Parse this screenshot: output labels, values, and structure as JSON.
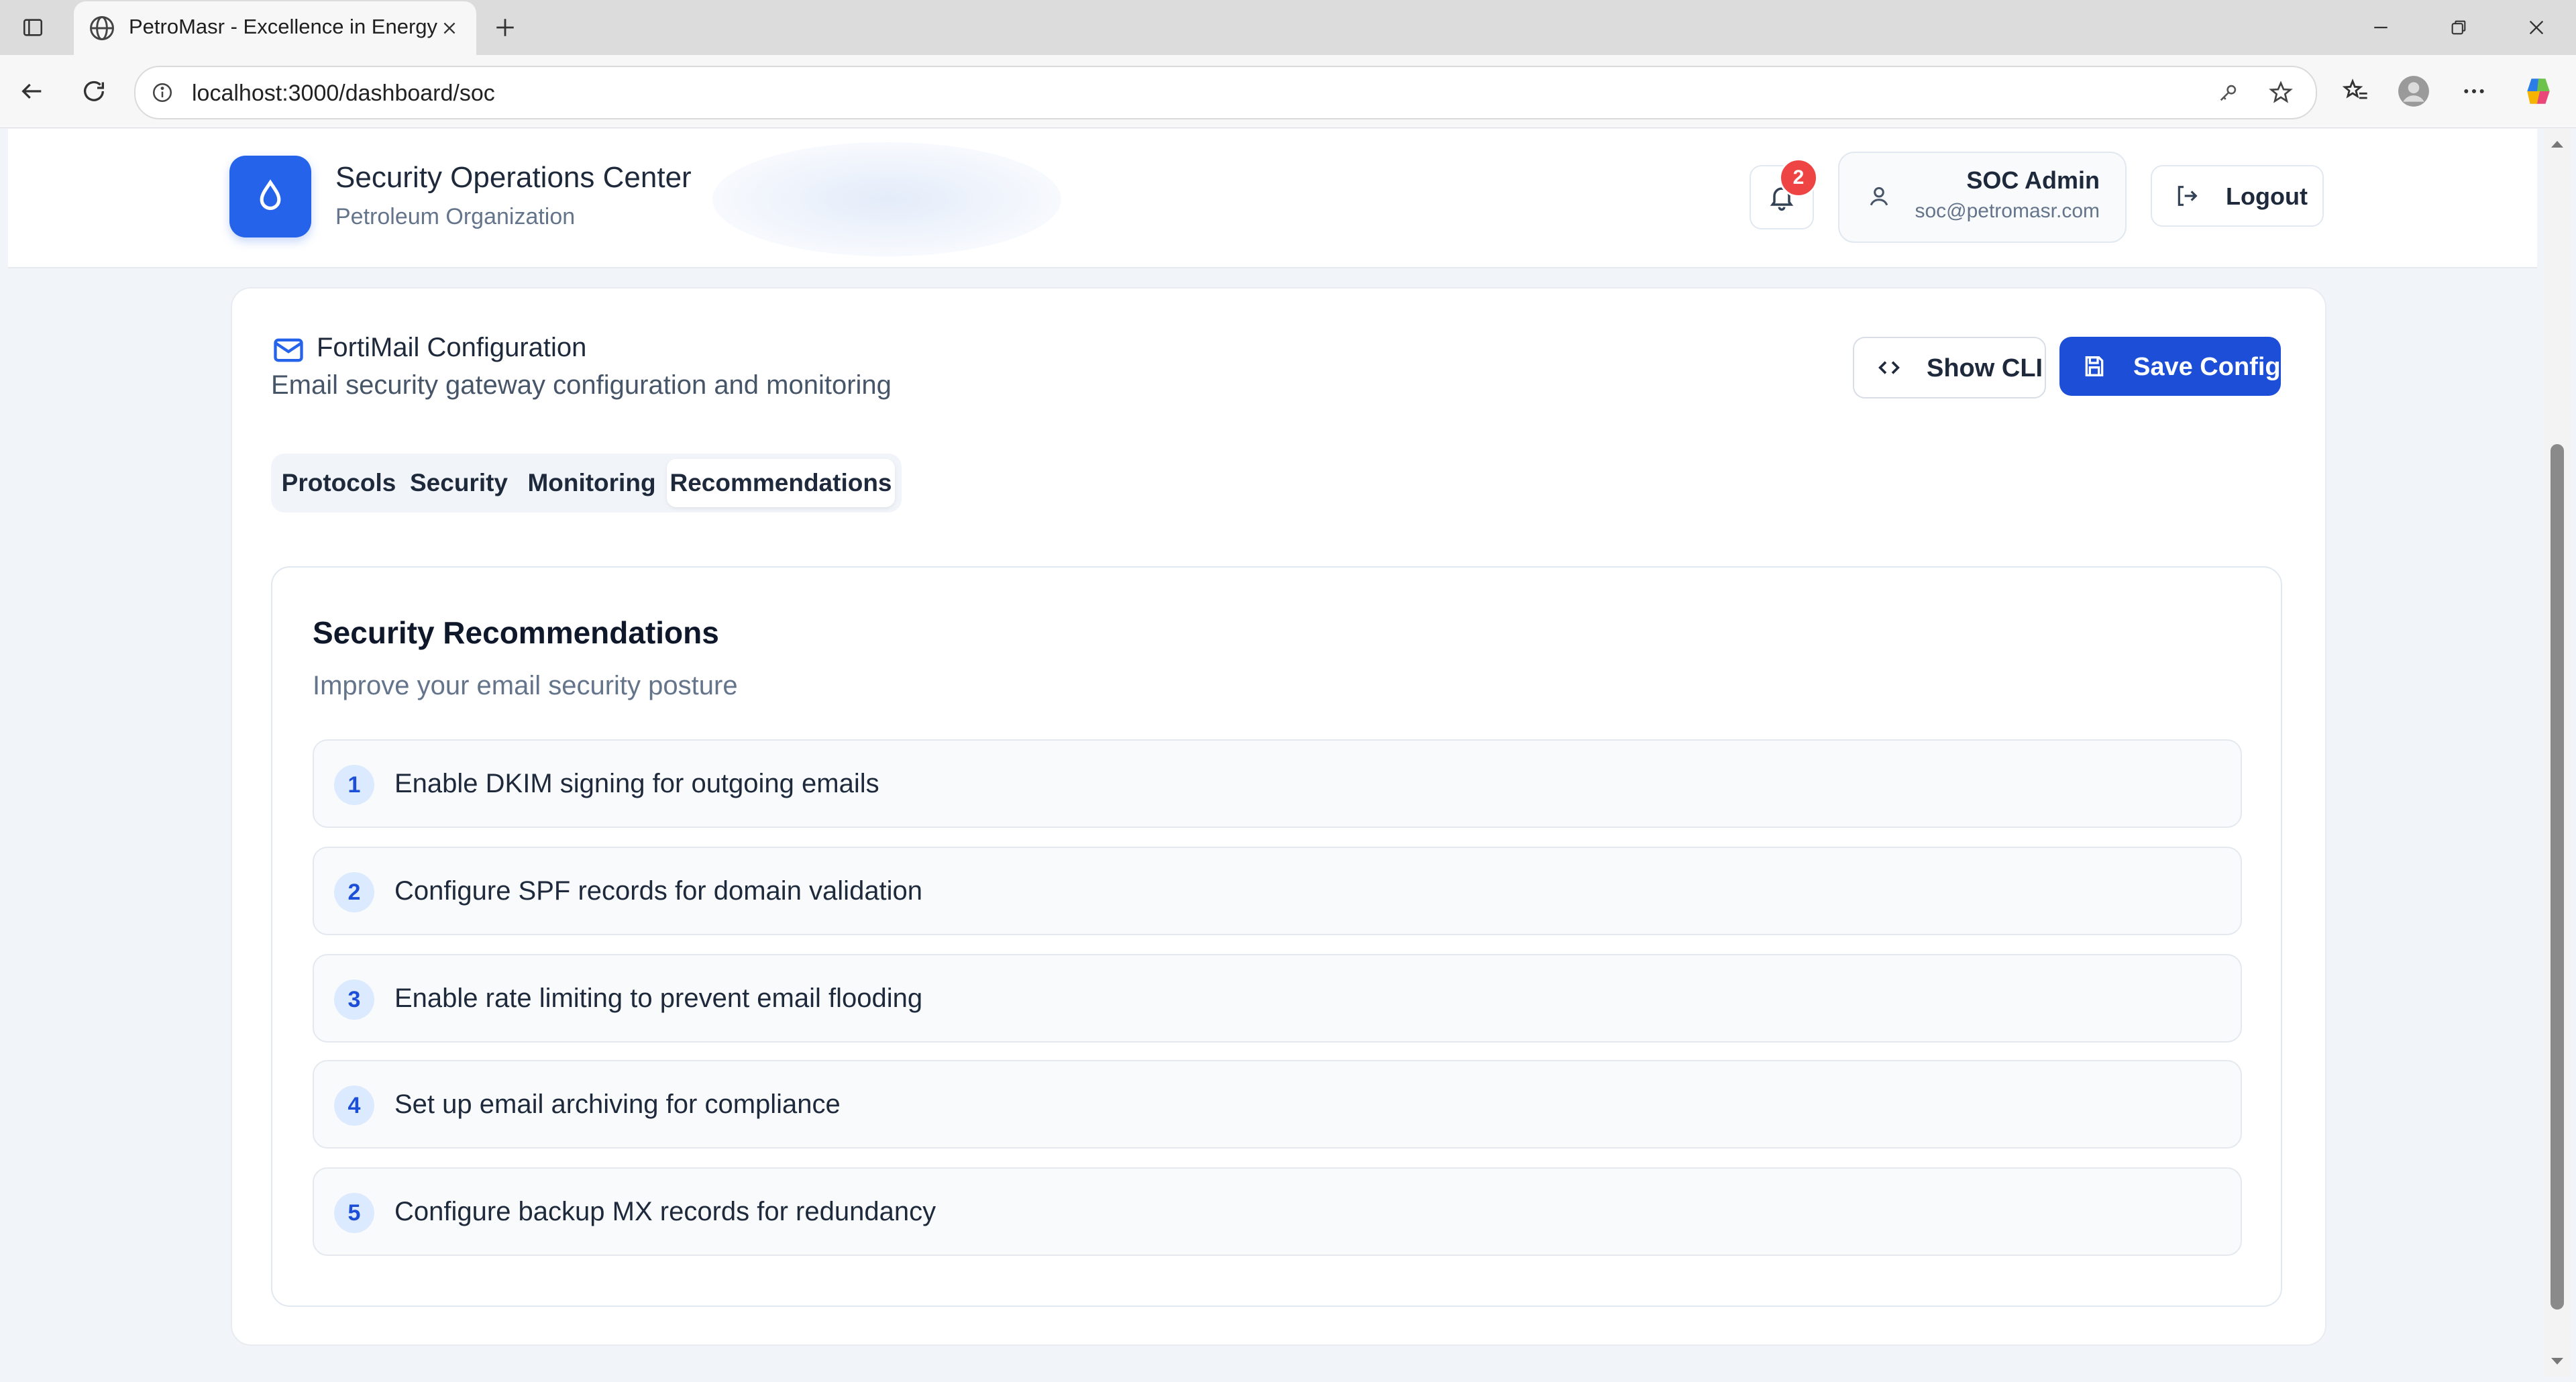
{
  "browser": {
    "tab_title": "PetroMasr - Excellence in Energy",
    "url": "localhost:3000/dashboard/soc"
  },
  "header": {
    "title": "Security Operations Center",
    "subtitle": "Petroleum Organization",
    "notification_count": "2",
    "user_name": "SOC Admin",
    "user_email": "soc@petromasr.com",
    "logout_label": "Logout"
  },
  "config": {
    "title": "FortiMail Configuration",
    "description": "Email security gateway configuration and monitoring",
    "show_cli_label": "Show CLI",
    "save_label": "Save Config"
  },
  "tabs": [
    {
      "label": "Protocols",
      "active": false
    },
    {
      "label": "Security",
      "active": false
    },
    {
      "label": "Monitoring",
      "active": false
    },
    {
      "label": "Recommendations",
      "active": true
    }
  ],
  "recommendations": {
    "title": "Security Recommendations",
    "subtitle": "Improve your email security posture",
    "items": [
      {
        "num": "1",
        "text": "Enable DKIM signing for outgoing emails"
      },
      {
        "num": "2",
        "text": "Configure SPF records for domain validation"
      },
      {
        "num": "3",
        "text": "Enable rate limiting to prevent email flooding"
      },
      {
        "num": "4",
        "text": "Set up email archiving for compliance"
      },
      {
        "num": "5",
        "text": "Configure backup MX records for redundancy"
      }
    ]
  },
  "colors": {
    "accent": "#2563eb",
    "save_button": "#1d4ed8",
    "badge": "#ef4444",
    "page_bg": "#f1f4f8"
  }
}
